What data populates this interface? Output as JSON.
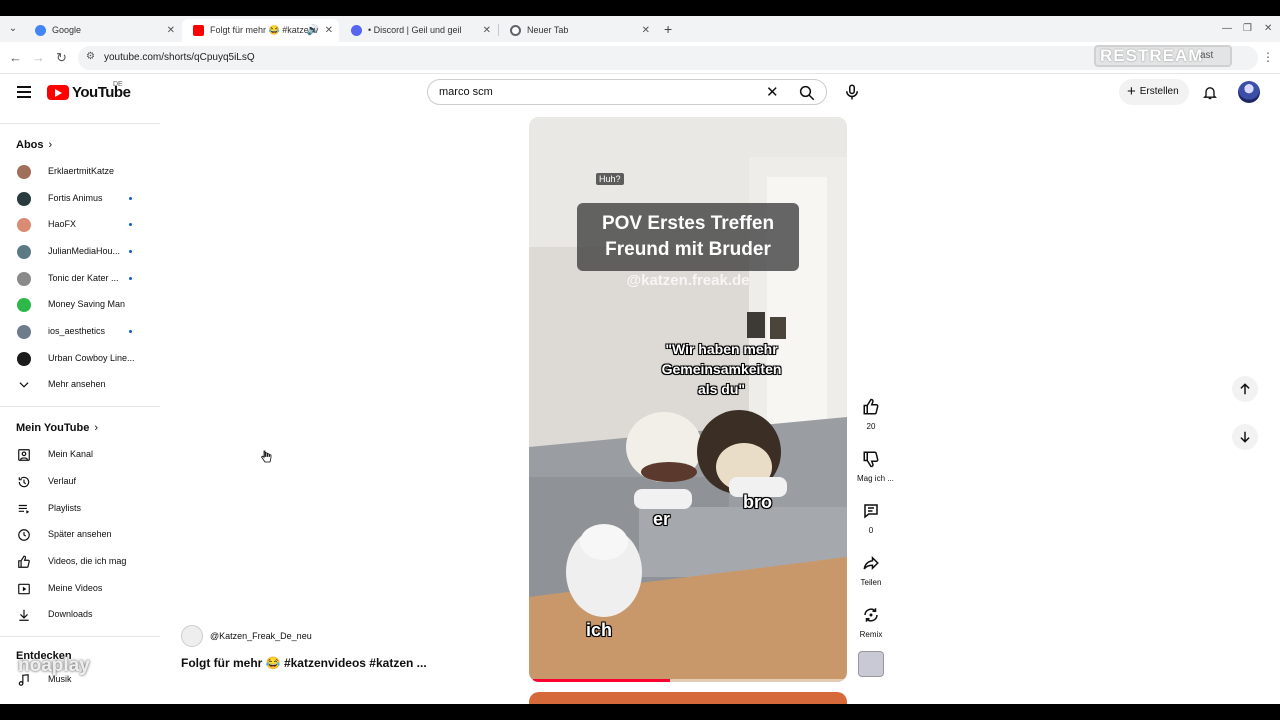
{
  "browser": {
    "tabs": [
      {
        "label": "Google",
        "favicon_color": "#4285f4",
        "active": false
      },
      {
        "label": "Folgt für mehr 😂 #katzenv",
        "favicon_color": "#ff0000",
        "active": true
      },
      {
        "label": "• Discord | Geil und geil",
        "favicon_color": "#5865f2",
        "active": false
      },
      {
        "label": "Neuer Tab",
        "favicon_color": "#5f6368",
        "active": false
      }
    ],
    "url": "youtube.com/shorts/qCpuyq5iLsQ",
    "profile_label": "ast",
    "restream_badge": "RESTREAM"
  },
  "youtube": {
    "wordmark": "YouTube",
    "region": "DE",
    "search_value": "marco scm",
    "create_label": "Erstellen",
    "accent": "#ff0000"
  },
  "sidebar": {
    "subscriptions_heading": "Abos",
    "channels": [
      {
        "name": "ErklaertmitKatze",
        "avatar_color": "#a1705a",
        "new": false
      },
      {
        "name": "Fortis Animus",
        "avatar_color": "#2a3b40",
        "new": true
      },
      {
        "name": "HaoFX",
        "avatar_color": "#d98b74",
        "new": true
      },
      {
        "name": "JulianMediaHou...",
        "avatar_color": "#5d7a84",
        "new": true
      },
      {
        "name": "Tonic der Kater ...",
        "avatar_color": "#8a8a8a",
        "new": true
      },
      {
        "name": "Money Saving Man",
        "avatar_color": "#2fb84a",
        "new": false
      },
      {
        "name": "ios_aesthetics",
        "avatar_color": "#6d7b8a",
        "new": true
      },
      {
        "name": "Urban Cowboy Line...",
        "avatar_color": "#1b1b1b",
        "new": false
      }
    ],
    "show_more": "Mehr ansehen",
    "you_heading": "Mein YouTube",
    "you_items": [
      {
        "label": "Mein Kanal",
        "icon": "channel-icon"
      },
      {
        "label": "Verlauf",
        "icon": "history-icon"
      },
      {
        "label": "Playlists",
        "icon": "playlists-icon"
      },
      {
        "label": "Später ansehen",
        "icon": "watch-later-icon"
      },
      {
        "label": "Videos, die ich mag",
        "icon": "like-icon"
      },
      {
        "label": "Meine Videos",
        "icon": "my-videos-icon"
      },
      {
        "label": "Downloads",
        "icon": "download-icon"
      }
    ],
    "explore_heading": "Entdecken",
    "explore_items": [
      {
        "label": "Musik",
        "icon": "music-icon"
      }
    ]
  },
  "short": {
    "channel": "@Katzen_Freak_De_neu",
    "title": "Folgt für mehr 😂 #katzenvideos #katzen ...",
    "overlay_huh": "Huh?",
    "caption_title": "POV Erstes Treffen\nFreund mit Bruder",
    "caption_title_line1": "POV Erstes Treffen",
    "caption_title_line2": "Freund mit Bruder",
    "watermark": "@katzen.freak.de",
    "quote_line1": "\"Wir haben mehr",
    "quote_line2": "Gemeinsamkeiten",
    "quote_line3": "als du\"",
    "label_er": "er",
    "label_bro": "bro",
    "label_ich": "ich",
    "progress_fraction": 0.43
  },
  "actions": {
    "like_count": "20",
    "dislike_label": "Mag ich ...",
    "comment_count": "0",
    "share_label": "Teilen",
    "remix_label": "Remix"
  },
  "overlay_watermark": "noaplay"
}
